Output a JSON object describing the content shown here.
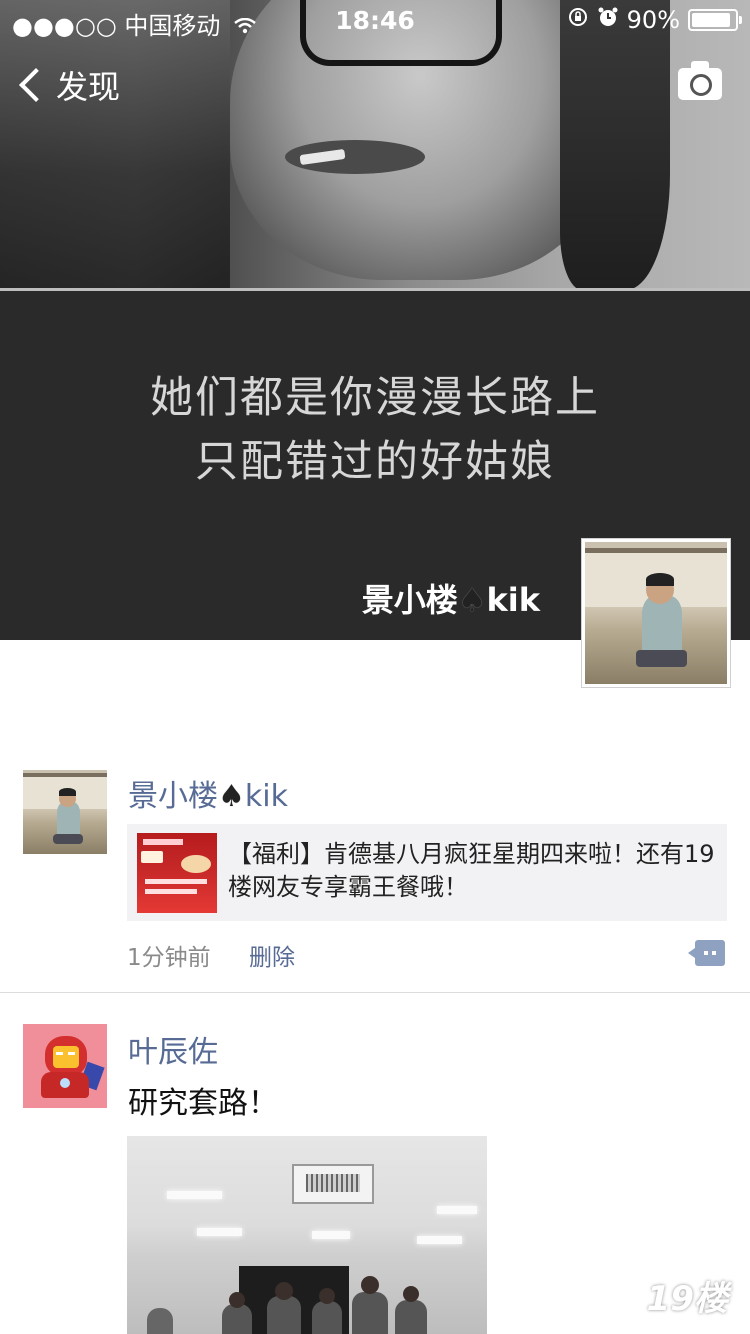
{
  "status_bar": {
    "carrier": "●●●○○ 中国移动",
    "time": "18:46",
    "battery_percent": "90%",
    "icons": [
      "signal-dots-icon",
      "wifi-icon",
      "rotation-lock-icon",
      "alarm-icon",
      "battery-icon"
    ]
  },
  "nav": {
    "back_label": "发现",
    "camera_icon": "camera-icon"
  },
  "cover": {
    "quote_line1": "她们都是你漫漫长路上",
    "quote_line2": "只配错过的好姑娘",
    "user_name": "景小楼",
    "user_suffix": "kik",
    "spade": "♠"
  },
  "posts": [
    {
      "author": "景小楼",
      "author_suffix": "kik",
      "link_title": "【福利】肯德基八月疯狂星期四来啦！还有19楼网友专享霸王餐哦！",
      "time": "1分钟前",
      "delete_label": "删除"
    },
    {
      "author": "叶辰佐",
      "text": "研究套路！"
    }
  ],
  "watermark": "19楼",
  "colors": {
    "name_link": "#576b95",
    "meta": "#8a8a8a",
    "card_bg": "#f2f2f4"
  }
}
